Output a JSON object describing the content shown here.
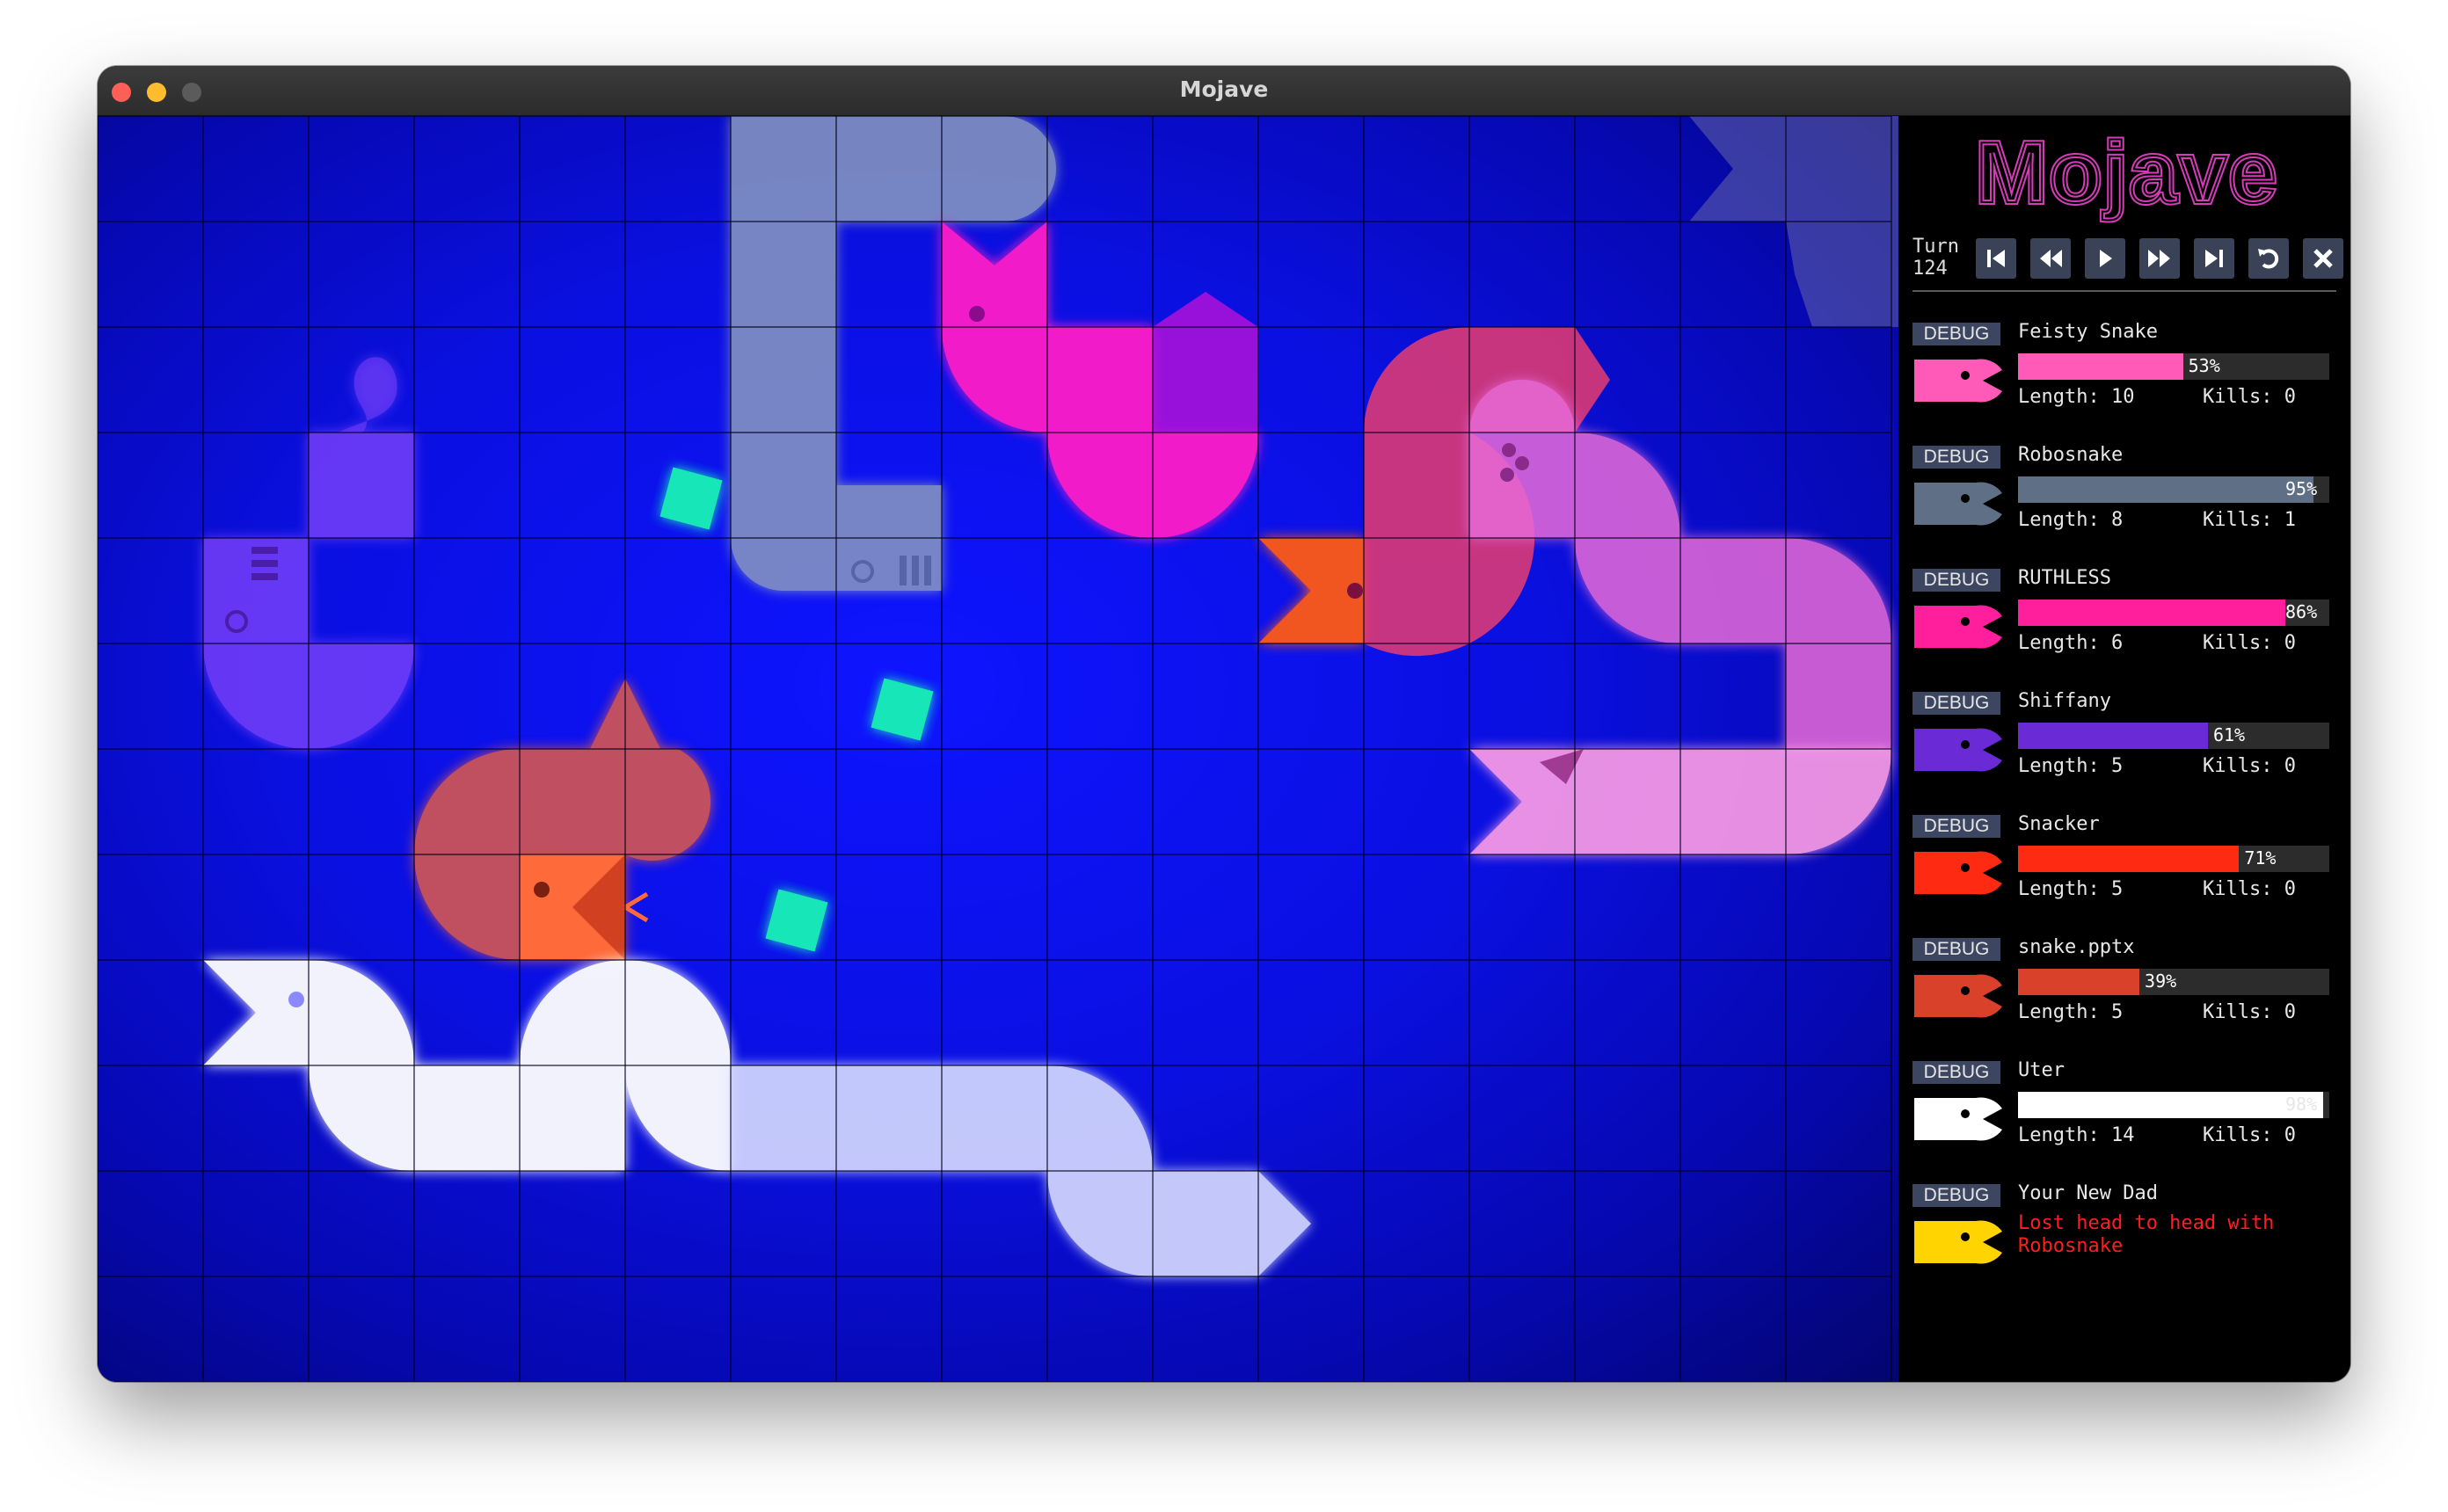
{
  "window": {
    "title": "Mojave"
  },
  "game": {
    "logo_text": "Mojave",
    "turn_label": "Turn",
    "turn_number": "124"
  },
  "controls": [
    {
      "name": "first-turn-button",
      "icon": "skip-back-icon"
    },
    {
      "name": "previous-turn-button",
      "icon": "rewind-icon"
    },
    {
      "name": "play-button",
      "icon": "play-icon"
    },
    {
      "name": "next-turn-button",
      "icon": "fast-forward-icon"
    },
    {
      "name": "last-turn-button",
      "icon": "skip-forward-icon"
    },
    {
      "name": "reload-button",
      "icon": "undo-icon"
    },
    {
      "name": "close-button",
      "icon": "close-icon"
    }
  ],
  "debug_label": "DEBUG",
  "length_label": "Length:",
  "kills_label": "Kills:",
  "snakes": [
    {
      "name": "Feisty Snake",
      "health": 53,
      "health_text": "53%",
      "length": "10",
      "kills": "0",
      "color": "#ff5ab8",
      "alive": true
    },
    {
      "name": "Robosnake",
      "health": 95,
      "health_text": "95%",
      "length": "8",
      "kills": "1",
      "color": "#5f6f85",
      "alive": true
    },
    {
      "name": "RUTHLESS",
      "health": 86,
      "health_text": "86%",
      "length": "6",
      "kills": "0",
      "color": "#ff1e9c",
      "alive": true
    },
    {
      "name": "Shiffany",
      "health": 61,
      "health_text": "61%",
      "length": "5",
      "kills": "0",
      "color": "#6a2bd6",
      "alive": true
    },
    {
      "name": "Snacker",
      "health": 71,
      "health_text": "71%",
      "length": "5",
      "kills": "0",
      "color": "#ff2a12",
      "alive": true
    },
    {
      "name": "snake.pptx",
      "health": 39,
      "health_text": "39%",
      "length": "5",
      "kills": "0",
      "color": "#d9412a",
      "alive": true
    },
    {
      "name": "Uter",
      "health": 98,
      "health_text": "98%",
      "length": "14",
      "kills": "0",
      "color": "#ffffff",
      "alive": true
    },
    {
      "name": "Your New Dad",
      "color": "#ffd400",
      "alive": false,
      "status_line1": "Lost head to head with",
      "status_line2": "Robosnake"
    }
  ],
  "board": {
    "width": 17,
    "height": 12,
    "food_color": "#18e6b8",
    "food": [
      [
        5.5,
        3.5
      ],
      [
        7.5,
        5.5
      ],
      [
        6.5,
        7.5
      ]
    ]
  }
}
